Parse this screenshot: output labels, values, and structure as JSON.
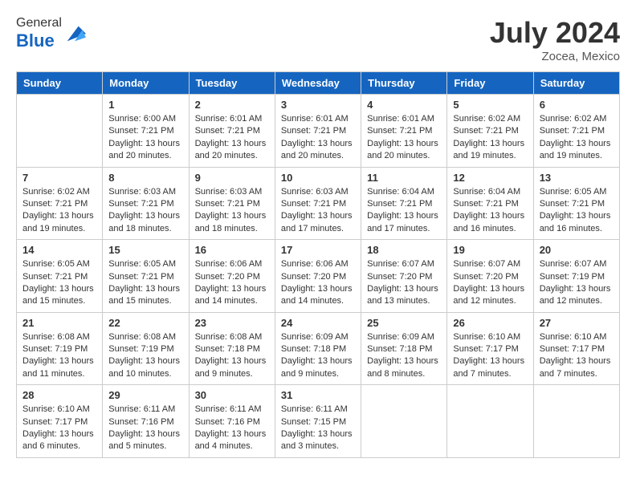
{
  "header": {
    "logo_general": "General",
    "logo_blue": "Blue",
    "month_title": "July 2024",
    "location": "Zocea, Mexico"
  },
  "weekdays": [
    "Sunday",
    "Monday",
    "Tuesday",
    "Wednesday",
    "Thursday",
    "Friday",
    "Saturday"
  ],
  "weeks": [
    [
      {
        "day": "",
        "sunrise": "",
        "sunset": "",
        "daylight": ""
      },
      {
        "day": "1",
        "sunrise": "Sunrise: 6:00 AM",
        "sunset": "Sunset: 7:21 PM",
        "daylight": "Daylight: 13 hours and 20 minutes."
      },
      {
        "day": "2",
        "sunrise": "Sunrise: 6:01 AM",
        "sunset": "Sunset: 7:21 PM",
        "daylight": "Daylight: 13 hours and 20 minutes."
      },
      {
        "day": "3",
        "sunrise": "Sunrise: 6:01 AM",
        "sunset": "Sunset: 7:21 PM",
        "daylight": "Daylight: 13 hours and 20 minutes."
      },
      {
        "day": "4",
        "sunrise": "Sunrise: 6:01 AM",
        "sunset": "Sunset: 7:21 PM",
        "daylight": "Daylight: 13 hours and 20 minutes."
      },
      {
        "day": "5",
        "sunrise": "Sunrise: 6:02 AM",
        "sunset": "Sunset: 7:21 PM",
        "daylight": "Daylight: 13 hours and 19 minutes."
      },
      {
        "day": "6",
        "sunrise": "Sunrise: 6:02 AM",
        "sunset": "Sunset: 7:21 PM",
        "daylight": "Daylight: 13 hours and 19 minutes."
      }
    ],
    [
      {
        "day": "7",
        "sunrise": "Sunrise: 6:02 AM",
        "sunset": "Sunset: 7:21 PM",
        "daylight": "Daylight: 13 hours and 19 minutes."
      },
      {
        "day": "8",
        "sunrise": "Sunrise: 6:03 AM",
        "sunset": "Sunset: 7:21 PM",
        "daylight": "Daylight: 13 hours and 18 minutes."
      },
      {
        "day": "9",
        "sunrise": "Sunrise: 6:03 AM",
        "sunset": "Sunset: 7:21 PM",
        "daylight": "Daylight: 13 hours and 18 minutes."
      },
      {
        "day": "10",
        "sunrise": "Sunrise: 6:03 AM",
        "sunset": "Sunset: 7:21 PM",
        "daylight": "Daylight: 13 hours and 17 minutes."
      },
      {
        "day": "11",
        "sunrise": "Sunrise: 6:04 AM",
        "sunset": "Sunset: 7:21 PM",
        "daylight": "Daylight: 13 hours and 17 minutes."
      },
      {
        "day": "12",
        "sunrise": "Sunrise: 6:04 AM",
        "sunset": "Sunset: 7:21 PM",
        "daylight": "Daylight: 13 hours and 16 minutes."
      },
      {
        "day": "13",
        "sunrise": "Sunrise: 6:05 AM",
        "sunset": "Sunset: 7:21 PM",
        "daylight": "Daylight: 13 hours and 16 minutes."
      }
    ],
    [
      {
        "day": "14",
        "sunrise": "Sunrise: 6:05 AM",
        "sunset": "Sunset: 7:21 PM",
        "daylight": "Daylight: 13 hours and 15 minutes."
      },
      {
        "day": "15",
        "sunrise": "Sunrise: 6:05 AM",
        "sunset": "Sunset: 7:21 PM",
        "daylight": "Daylight: 13 hours and 15 minutes."
      },
      {
        "day": "16",
        "sunrise": "Sunrise: 6:06 AM",
        "sunset": "Sunset: 7:20 PM",
        "daylight": "Daylight: 13 hours and 14 minutes."
      },
      {
        "day": "17",
        "sunrise": "Sunrise: 6:06 AM",
        "sunset": "Sunset: 7:20 PM",
        "daylight": "Daylight: 13 hours and 14 minutes."
      },
      {
        "day": "18",
        "sunrise": "Sunrise: 6:07 AM",
        "sunset": "Sunset: 7:20 PM",
        "daylight": "Daylight: 13 hours and 13 minutes."
      },
      {
        "day": "19",
        "sunrise": "Sunrise: 6:07 AM",
        "sunset": "Sunset: 7:20 PM",
        "daylight": "Daylight: 13 hours and 12 minutes."
      },
      {
        "day": "20",
        "sunrise": "Sunrise: 6:07 AM",
        "sunset": "Sunset: 7:19 PM",
        "daylight": "Daylight: 13 hours and 12 minutes."
      }
    ],
    [
      {
        "day": "21",
        "sunrise": "Sunrise: 6:08 AM",
        "sunset": "Sunset: 7:19 PM",
        "daylight": "Daylight: 13 hours and 11 minutes."
      },
      {
        "day": "22",
        "sunrise": "Sunrise: 6:08 AM",
        "sunset": "Sunset: 7:19 PM",
        "daylight": "Daylight: 13 hours and 10 minutes."
      },
      {
        "day": "23",
        "sunrise": "Sunrise: 6:08 AM",
        "sunset": "Sunset: 7:18 PM",
        "daylight": "Daylight: 13 hours and 9 minutes."
      },
      {
        "day": "24",
        "sunrise": "Sunrise: 6:09 AM",
        "sunset": "Sunset: 7:18 PM",
        "daylight": "Daylight: 13 hours and 9 minutes."
      },
      {
        "day": "25",
        "sunrise": "Sunrise: 6:09 AM",
        "sunset": "Sunset: 7:18 PM",
        "daylight": "Daylight: 13 hours and 8 minutes."
      },
      {
        "day": "26",
        "sunrise": "Sunrise: 6:10 AM",
        "sunset": "Sunset: 7:17 PM",
        "daylight": "Daylight: 13 hours and 7 minutes."
      },
      {
        "day": "27",
        "sunrise": "Sunrise: 6:10 AM",
        "sunset": "Sunset: 7:17 PM",
        "daylight": "Daylight: 13 hours and 7 minutes."
      }
    ],
    [
      {
        "day": "28",
        "sunrise": "Sunrise: 6:10 AM",
        "sunset": "Sunset: 7:17 PM",
        "daylight": "Daylight: 13 hours and 6 minutes."
      },
      {
        "day": "29",
        "sunrise": "Sunrise: 6:11 AM",
        "sunset": "Sunset: 7:16 PM",
        "daylight": "Daylight: 13 hours and 5 minutes."
      },
      {
        "day": "30",
        "sunrise": "Sunrise: 6:11 AM",
        "sunset": "Sunset: 7:16 PM",
        "daylight": "Daylight: 13 hours and 4 minutes."
      },
      {
        "day": "31",
        "sunrise": "Sunrise: 6:11 AM",
        "sunset": "Sunset: 7:15 PM",
        "daylight": "Daylight: 13 hours and 3 minutes."
      },
      {
        "day": "",
        "sunrise": "",
        "sunset": "",
        "daylight": ""
      },
      {
        "day": "",
        "sunrise": "",
        "sunset": "",
        "daylight": ""
      },
      {
        "day": "",
        "sunrise": "",
        "sunset": "",
        "daylight": ""
      }
    ]
  ]
}
